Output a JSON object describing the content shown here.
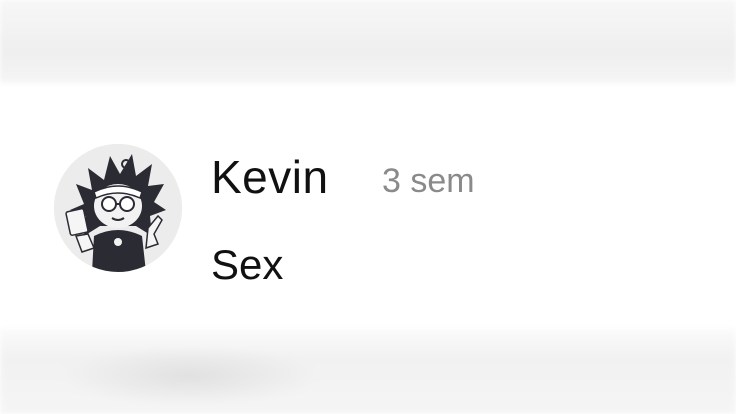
{
  "comment": {
    "username": "Kevin",
    "time": "3 sem",
    "text": "Sex",
    "avatar_icon": "user-avatar-drawing"
  },
  "colors": {
    "username": "#111111",
    "time": "#8a8a8a",
    "background": "#ffffff"
  }
}
